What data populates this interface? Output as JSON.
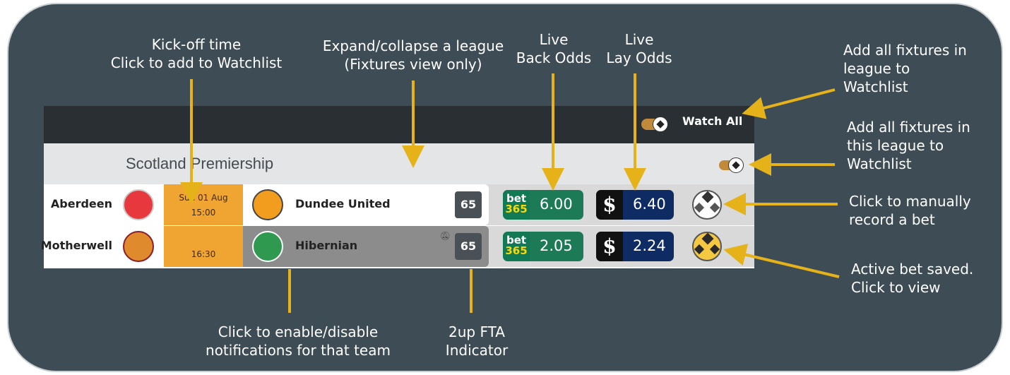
{
  "annotations": {
    "kickoff": [
      "Kick-off time",
      "Click to add to Watchlist"
    ],
    "expand": [
      "Expand/collapse a league",
      "(Fixtures view only)"
    ],
    "back_odds": [
      "Live",
      "Back Odds"
    ],
    "lay_odds": [
      "Live",
      "Lay Odds"
    ],
    "watch_all_top": [
      "Add all fixtures in",
      "league to",
      "Watchlist"
    ],
    "watch_league": [
      "Add all fixtures in",
      "this league to",
      "Watchlist"
    ],
    "manual_bet": [
      "Click to manually",
      "record a bet"
    ],
    "active_bet": [
      "Active bet saved.",
      "Click to view"
    ],
    "notifications": [
      "Click to enable/disable",
      "notifications for that team"
    ],
    "fta": [
      "2up FTA",
      "Indicator"
    ]
  },
  "topbar": {
    "watch_all_label": "Watch All"
  },
  "league": {
    "name": "Scotland Premiership"
  },
  "fixtures": [
    {
      "home": "Aberdeen",
      "date": "Sun 01 Aug",
      "time": "15:00",
      "away": "Dundee United",
      "fta": "65",
      "back_logo_top": "bet",
      "back_logo_bottom": "365",
      "back_odds": "6.00",
      "lay_logo": "$",
      "lay_odds": "6.40",
      "bet_status": "none"
    },
    {
      "home": "Motherwell",
      "date": "",
      "time": "16:30",
      "away": "Hibernian",
      "fta": "65",
      "back_logo_top": "bet",
      "back_logo_bottom": "365",
      "back_odds": "2.05",
      "lay_logo": "$",
      "lay_odds": "2.24",
      "bet_status": "active"
    }
  ],
  "colors": {
    "background": "#3e4c55",
    "accent_arrow": "#e5b219",
    "kickoff": "#f0a532",
    "back": "#1c7a57",
    "lay": "#0e2b63"
  },
  "icons": {
    "watch_toggle": "football-toggle-icon",
    "bell": "bell-muted-icon",
    "manual_bet": "football-icon",
    "active_bet": "football-bet-saved-icon"
  }
}
